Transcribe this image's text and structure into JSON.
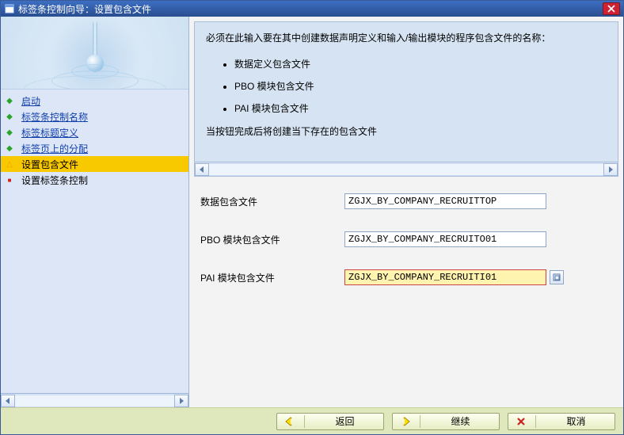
{
  "window": {
    "title": "标签条控制向导：设置包含文件"
  },
  "sidebar": {
    "items": [
      {
        "label": "启动",
        "state": "done"
      },
      {
        "label": "标签条控制名称",
        "state": "done"
      },
      {
        "label": "标签标题定义",
        "state": "done"
      },
      {
        "label": "标签页上的分配",
        "state": "done"
      },
      {
        "label": "设置包含文件",
        "state": "current"
      },
      {
        "label": "设置标签条控制",
        "state": "pending"
      }
    ]
  },
  "info": {
    "intro": "必须在此输入要在其中创建数据声明定义和输入/输出模块的程序包含文件的名称：",
    "bullets": [
      "数据定义包含文件",
      "PBO 模块包含文件",
      "PAI 模块包含文件"
    ],
    "truncated": "当按钮完成后将创建当下存在的包含文件"
  },
  "form": {
    "rows": [
      {
        "label": "数据包含文件",
        "value": "ZGJX_BY_COMPANY_RECRUITTOP",
        "active": false
      },
      {
        "label": "PBO 模块包含文件",
        "value": "ZGJX_BY_COMPANY_RECRUITO01",
        "active": false
      },
      {
        "label": "PAI 模块包含文件",
        "value": "ZGJX_BY_COMPANY_RECRUITI01",
        "active": true
      }
    ]
  },
  "buttons": {
    "back": "返回",
    "continue": "继续",
    "cancel": "取消"
  }
}
